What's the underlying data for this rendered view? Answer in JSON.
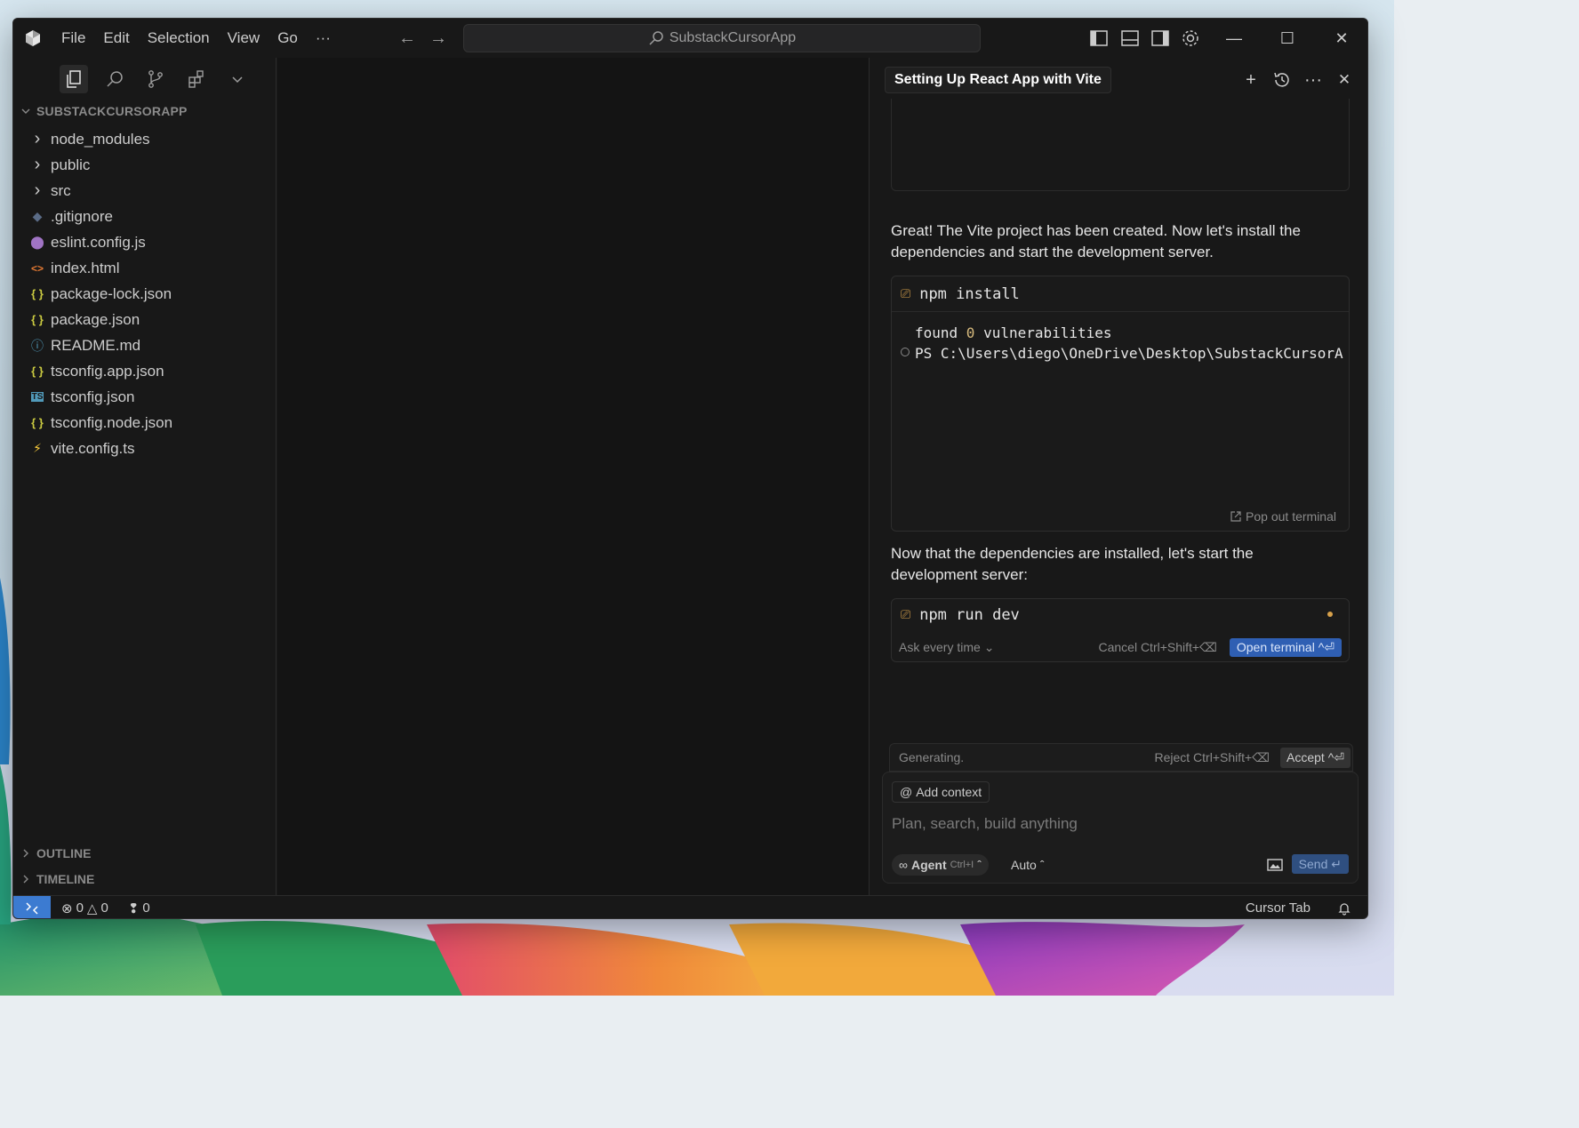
{
  "window": {
    "search_text": "SubstackCursorApp"
  },
  "menu": [
    "File",
    "Edit",
    "Selection",
    "View",
    "Go",
    "···"
  ],
  "explorer": {
    "project_name": "SUBSTACKCURSORAPP",
    "items": [
      {
        "label": "node_modules",
        "type": "folder",
        "icon": "chevron-right-icon"
      },
      {
        "label": "public",
        "type": "folder",
        "icon": "chevron-right-icon"
      },
      {
        "label": "src",
        "type": "folder",
        "icon": "chevron-right-icon"
      },
      {
        "label": ".gitignore",
        "type": "file",
        "icon": "git-icon",
        "color": "#5a6b86"
      },
      {
        "label": "eslint.config.js",
        "type": "file",
        "icon": "eslint-icon",
        "color": "#a074c4"
      },
      {
        "label": "index.html",
        "type": "file",
        "icon": "html-icon",
        "color": "#e37933"
      },
      {
        "label": "package-lock.json",
        "type": "file",
        "icon": "json-icon",
        "color": "#cbcb41"
      },
      {
        "label": "package.json",
        "type": "file",
        "icon": "json-icon",
        "color": "#cbcb41"
      },
      {
        "label": "README.md",
        "type": "file",
        "icon": "info-icon",
        "color": "#519aba"
      },
      {
        "label": "tsconfig.app.json",
        "type": "file",
        "icon": "json-icon",
        "color": "#cbcb41"
      },
      {
        "label": "tsconfig.json",
        "type": "file",
        "icon": "ts-icon",
        "color": "#519aba"
      },
      {
        "label": "tsconfig.node.json",
        "type": "file",
        "icon": "json-icon",
        "color": "#cbcb41"
      },
      {
        "label": "vite.config.ts",
        "type": "file",
        "icon": "vite-icon",
        "color": "#ffcf3c"
      }
    ],
    "outline_label": "OUTLINE",
    "timeline_label": "TIMELINE"
  },
  "chat": {
    "tab_title": "Setting Up React App with Vite",
    "message_1": "Great! The Vite project has been created. Now let's install the dependencies and start the development server.",
    "terminal_1": {
      "command": "npm install",
      "line_1_prefix": "found ",
      "line_1_num": "0",
      "line_1_suffix": " vulnerabilities",
      "line_2": "PS C:\\Users\\diego\\OneDrive\\Desktop\\SubstackCursorA",
      "pop_out_label": "Pop out terminal"
    },
    "message_2": "Now that the dependencies are installed, let's start the development server:",
    "terminal_2": {
      "command": "npm run dev",
      "ask_label": "Ask every time",
      "cancel_label": "Cancel Ctrl+Shift+⌫",
      "open_terminal_label": "Open terminal ^⏎"
    },
    "generating_label": "Generating.",
    "reject_label": "Reject Ctrl+Shift+⌫",
    "accept_label": "Accept ^⏎",
    "add_context_label": "Add context",
    "input_placeholder": "Plan, search, build anything",
    "agent_label": "Agent",
    "agent_shortcut": "Ctrl+I",
    "model_label": "Auto",
    "send_label": "Send"
  },
  "statusbar": {
    "errors": "0",
    "warnings": "0",
    "ports": "0",
    "cursor_tab": "Cursor Tab"
  },
  "colors": {
    "accent": "#3c7bd1",
    "send": "#2f4f80",
    "window_bg": "#181818"
  }
}
